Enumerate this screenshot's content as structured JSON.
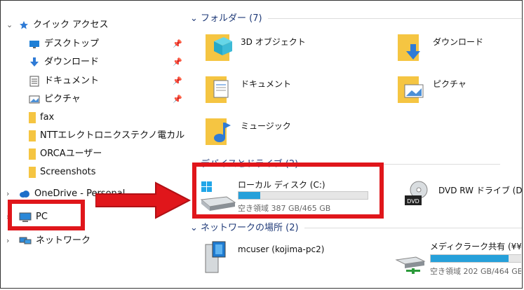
{
  "colors": {
    "highlight": "#e0161b",
    "progress": "#26a0da",
    "folder": "#f5c542"
  },
  "nav": {
    "quick_access": "クイック アクセス",
    "items": [
      {
        "label": "デスクトップ",
        "icon": "desktop-icon",
        "pinned": true
      },
      {
        "label": "ダウンロード",
        "icon": "download-icon",
        "pinned": true
      },
      {
        "label": "ドキュメント",
        "icon": "document-icon",
        "pinned": true
      },
      {
        "label": "ピクチャ",
        "icon": "picture-icon",
        "pinned": true
      },
      {
        "label": "fax",
        "icon": "folder-icon",
        "pinned": false
      },
      {
        "label": "NTTエレクトロニクステクノ電カルユーザー",
        "icon": "folder-icon",
        "pinned": false
      },
      {
        "label": "ORCAユーザー",
        "icon": "folder-icon",
        "pinned": false
      },
      {
        "label": "Screenshots",
        "icon": "folder-icon",
        "pinned": false
      }
    ],
    "onedrive": "OneDrive - Personal",
    "pc": "PC",
    "network": "ネットワーク"
  },
  "main": {
    "folders_header": "フォルダー (7)",
    "folders": [
      {
        "label": "3D オブジェクト",
        "icon": "3d-objects-icon"
      },
      {
        "label": "ダウンロード",
        "icon": "downloads-folder-icon"
      },
      {
        "label": "ドキュメント",
        "icon": "documents-folder-icon"
      },
      {
        "label": "ピクチャ",
        "icon": "pictures-folder-icon"
      },
      {
        "label": "ミュージック",
        "icon": "music-folder-icon"
      }
    ],
    "devices_header": "デバイスとドライブ (2)",
    "drives": [
      {
        "label": "ローカル ディスク (C:)",
        "space": "空き領域 387 GB/465 GB",
        "used_fraction": 0.17
      },
      {
        "label": "DVD RW ドライブ (D:)"
      }
    ],
    "network_header": "ネットワークの場所 (2)",
    "network": [
      {
        "label": "mcuser (kojima-pc2)"
      },
      {
        "label": "メディクラーク共有 (¥¥Mcs",
        "space": "空き領域 202 GB/464 GB",
        "used_fraction": 0.56
      }
    ]
  }
}
